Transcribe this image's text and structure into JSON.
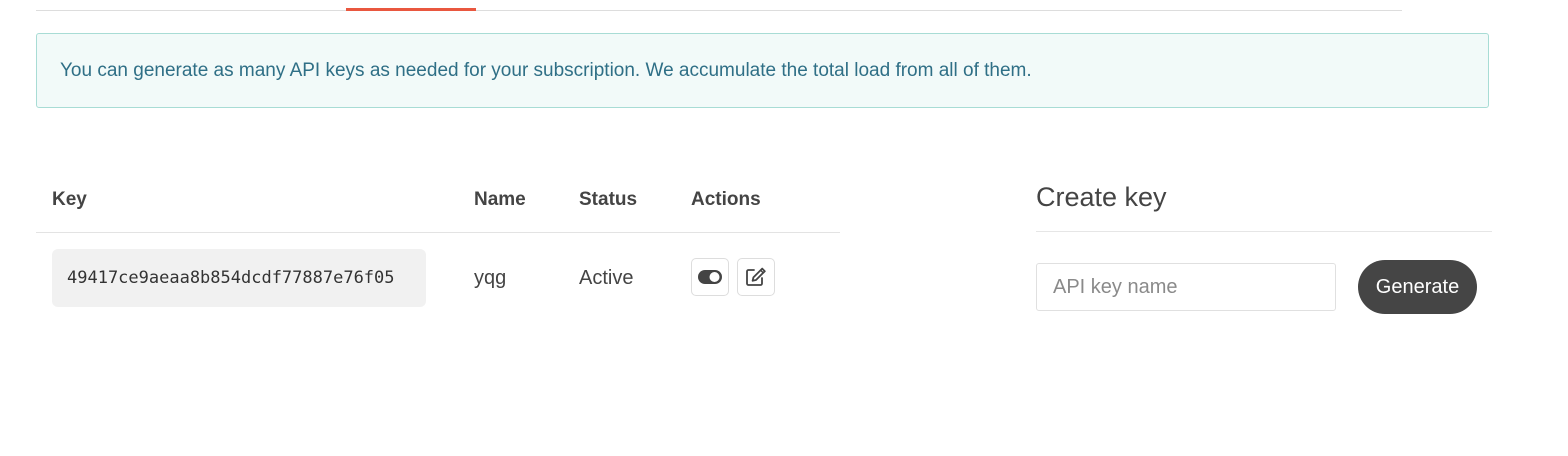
{
  "tabs": {
    "accent_color": "#e9573f"
  },
  "alert": {
    "text": "You can generate as many API keys as needed for your subscription. We accumulate the total load from all of them."
  },
  "keys_table": {
    "columns": {
      "key": "Key",
      "name": "Name",
      "status": "Status",
      "actions": "Actions"
    },
    "rows": [
      {
        "key": "49417ce9aeaa8b854dcdf77887e76f05",
        "name": "yqg",
        "status": "Active",
        "actions": [
          {
            "icon": "toggle-icon"
          },
          {
            "icon": "edit-icon"
          }
        ]
      }
    ]
  },
  "create_key": {
    "title": "Create key",
    "input_placeholder": "API key name",
    "input_value": "",
    "button_label": "Generate"
  },
  "colors": {
    "alert_background": "#f2faf9",
    "alert_border": "#a8dcd5",
    "alert_text": "#2f6f86",
    "button_background": "#454545"
  }
}
